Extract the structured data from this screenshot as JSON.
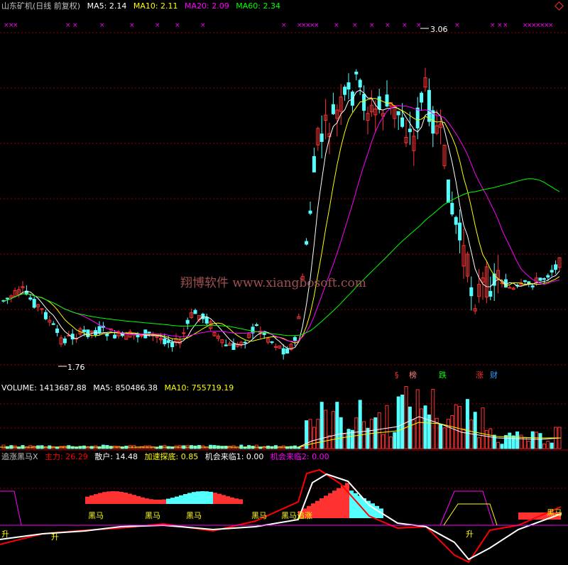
{
  "main_header": {
    "title": "山东矿机(日线 前复权)",
    "ma5": {
      "label": "MA5:",
      "value": "2.14",
      "color": "#ffffff"
    },
    "ma10": {
      "label": "MA10:",
      "value": "2.11",
      "color": "#ffff00"
    },
    "ma20": {
      "label": "MA20:",
      "value": "2.09",
      "color": "#ff00ff"
    },
    "ma60": {
      "label": "MA60:",
      "value": "2.34",
      "color": "#00ff00"
    }
  },
  "main_chart": {
    "high_label": "3.06",
    "low_label": "1.76",
    "watermark": "翔博软件 www.xiangbosoft.com",
    "event_tags": [
      {
        "text": "§",
        "color": "#ff3030"
      },
      {
        "text": "榜",
        "color": "#ff6060"
      },
      {
        "text": "跌",
        "color": "#00ff00"
      },
      {
        "text": "涨",
        "color": "#ff3030"
      },
      {
        "text": "财",
        "color": "#30a0ff"
      }
    ]
  },
  "volume_header": {
    "volume": {
      "label": "VOLUME:",
      "value": "1413687.88",
      "color": "#ffffff"
    },
    "ma5": {
      "label": "MA5:",
      "value": "850486.38",
      "color": "#ffffff"
    },
    "ma10": {
      "label": "MA10:",
      "value": "755719.19",
      "color": "#ffff00"
    }
  },
  "indicator_header": {
    "name": "追涨黑马X",
    "zhuli": {
      "label": "主力:",
      "value": "26.29",
      "color": "#ff0000"
    },
    "sanhu": {
      "label": "散户:",
      "value": "14.48",
      "color": "#ffffff"
    },
    "jiasu": {
      "label": "加速探底:",
      "value": "0.85",
      "color": "#ffff00"
    },
    "jihui1": {
      "label": "机会来临1:",
      "value": "0.00",
      "color": "#ffffff"
    },
    "jihui2": {
      "label": "机会来临2:",
      "value": "0.00",
      "color": "#ff00ff"
    }
  },
  "indicator_labels": {
    "heima": "黑马",
    "sheng": "升",
    "heima_zhang": "黑马追涨"
  },
  "colors": {
    "up": "#ff3232",
    "down": "#54ffff",
    "ma5": "#ffffff",
    "ma10": "#ffff00",
    "ma20": "#ff00ff",
    "ma60": "#00ff00"
  }
}
